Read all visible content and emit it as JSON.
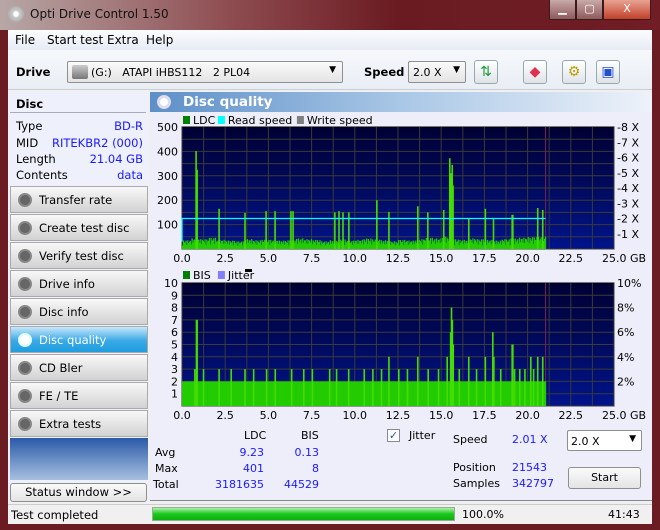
{
  "window": {
    "title": "Opti Drive Control 1.50",
    "minimize": "▁",
    "maximize": "▢",
    "close": "X"
  },
  "menu": [
    "File",
    "Start test",
    "Extra",
    "Help"
  ],
  "toolbar": {
    "drive_label": "Drive",
    "drive_value": "(G:)   ATAPI iHBS112   2 PL04",
    "speed_label": "Speed",
    "speed_value": "2.0 X",
    "icons": [
      "refresh-icon",
      "eraser-icon",
      "settings-icon",
      "save-icon"
    ]
  },
  "disc": {
    "header": "Disc",
    "rows": [
      {
        "label": "Type",
        "value": "BD-R"
      },
      {
        "label": "MID",
        "value": "RITEKBR2 (000)"
      },
      {
        "label": "Length",
        "value": "21.04 GB"
      },
      {
        "label": "Contents",
        "value": "data"
      }
    ]
  },
  "nav": [
    {
      "label": "Transfer rate"
    },
    {
      "label": "Create test disc"
    },
    {
      "label": "Verify test disc"
    },
    {
      "label": "Drive info"
    },
    {
      "label": "Disc info"
    },
    {
      "label": "Disc quality",
      "selected": true
    },
    {
      "label": "CD Bler"
    },
    {
      "label": "FE / TE"
    },
    {
      "label": "Extra tests"
    }
  ],
  "status_window_button": "Status window >>",
  "panel_title": "Disc quality",
  "chart_data": [
    {
      "type": "bar",
      "legend": [
        "LDC",
        "Read speed",
        "Write speed"
      ],
      "legend_colors": [
        "#008000",
        "#00ffff",
        "#808080"
      ],
      "x_ticks": [
        "0.0",
        "2.5",
        "5.0",
        "7.5",
        "10.0",
        "12.5",
        "15.0",
        "17.5",
        "20.0",
        "22.5",
        "25.0 GB"
      ],
      "y_ticks": [
        "500",
        "400",
        "300",
        "200",
        "100"
      ],
      "y2_ticks": [
        "8 X",
        "7 X",
        "6 X",
        "5 X",
        "4 X",
        "3 X",
        "2 X",
        "1 X"
      ],
      "xlim": [
        0,
        25
      ],
      "ylim": [
        0,
        500
      ],
      "y2lim": [
        0,
        8
      ],
      "data_end_gb": 21.04,
      "grid": true,
      "baseline_step_gb": 0.5,
      "baseline": [
        25,
        30,
        28,
        32,
        26,
        24,
        22,
        28,
        25,
        27,
        26,
        24,
        25,
        30,
        28,
        26,
        22,
        25,
        28,
        24,
        26,
        30,
        28,
        25,
        22,
        26,
        24,
        28,
        32,
        30,
        35,
        28,
        26,
        30,
        28,
        26,
        24,
        28,
        30,
        32,
        34,
        35,
        38
      ],
      "spikes": [
        [
          0.77,
          401
        ],
        [
          0.83,
          325
        ],
        [
          2.1,
          165
        ],
        [
          3.6,
          148
        ],
        [
          4.82,
          155
        ],
        [
          5.34,
          155
        ],
        [
          6.26,
          155
        ],
        [
          6.38,
          155
        ],
        [
          8.8,
          150
        ],
        [
          9.04,
          155
        ],
        [
          9.27,
          150
        ],
        [
          9.61,
          150
        ],
        [
          11.23,
          200
        ],
        [
          11.93,
          152
        ],
        [
          13.6,
          175
        ],
        [
          14.18,
          150
        ],
        [
          15.1,
          160
        ],
        [
          15.45,
          372
        ],
        [
          15.53,
          310
        ],
        [
          15.59,
          345
        ],
        [
          15.64,
          260
        ],
        [
          16.55,
          125
        ],
        [
          17.51,
          165
        ],
        [
          17.98,
          125
        ],
        [
          19.06,
          140
        ],
        [
          19.1,
          140
        ],
        [
          20.54,
          168
        ],
        [
          20.83,
          160
        ]
      ],
      "read_speed_x": 2.0
    },
    {
      "type": "bar",
      "legend": [
        "BIS",
        "Jitter"
      ],
      "legend_colors": [
        "#008000",
        "#8080ff"
      ],
      "x_ticks": [
        "0.0",
        "2.5",
        "5.0",
        "7.5",
        "10.0",
        "12.5",
        "15.0",
        "17.5",
        "20.0",
        "22.5",
        "25.0 GB"
      ],
      "y_ticks": [
        "10",
        "9",
        "8",
        "7",
        "6",
        "5",
        "4",
        "3",
        "2",
        "1"
      ],
      "y2_ticks": [
        "10%",
        "8%",
        "6%",
        "4%",
        "2%"
      ],
      "xlim": [
        0,
        25
      ],
      "ylim": [
        0,
        10
      ],
      "y2lim": [
        0,
        10
      ],
      "data_end_gb": 21.04,
      "grid": true,
      "baseline": 2,
      "spikes": [
        [
          0.79,
          7
        ],
        [
          0.83,
          7
        ],
        [
          15.5,
          6
        ],
        [
          15.55,
          8
        ],
        [
          15.6,
          7
        ],
        [
          15.65,
          5
        ],
        [
          17.94,
          6
        ],
        [
          19.06,
          5
        ],
        [
          19.1,
          5
        ],
        [
          11.93,
          4
        ],
        [
          13.6,
          4
        ],
        [
          15.3,
          4
        ],
        [
          16.55,
          4
        ],
        [
          17.51,
          4
        ],
        [
          18.0,
          4
        ],
        [
          20.14,
          4
        ],
        [
          20.54,
          4
        ],
        [
          20.83,
          4
        ],
        [
          0.7,
          3
        ],
        [
          1.2,
          3
        ],
        [
          2.1,
          3
        ],
        [
          2.8,
          3
        ],
        [
          3.6,
          3
        ],
        [
          4.1,
          3
        ],
        [
          4.85,
          3
        ],
        [
          5.35,
          3
        ],
        [
          6.3,
          3
        ],
        [
          7.0,
          3
        ],
        [
          7.5,
          3
        ],
        [
          8.5,
          3
        ],
        [
          8.9,
          3
        ],
        [
          9.6,
          3
        ],
        [
          10.5,
          3
        ],
        [
          11.0,
          3
        ],
        [
          11.5,
          3
        ],
        [
          12.5,
          3
        ],
        [
          13.0,
          3
        ],
        [
          14.2,
          3
        ],
        [
          14.8,
          3
        ],
        [
          16.0,
          3
        ],
        [
          17.0,
          3
        ],
        [
          18.4,
          3
        ],
        [
          19.2,
          3
        ],
        [
          19.5,
          3
        ],
        [
          19.8,
          3
        ],
        [
          20.3,
          3
        ]
      ]
    }
  ],
  "stats": {
    "col_ldc": "LDC",
    "col_bis": "BIS",
    "rows": [
      {
        "label": "Avg",
        "ldc": "9.23",
        "bis": "0.13"
      },
      {
        "label": "Max",
        "ldc": "401",
        "bis": "8"
      },
      {
        "label": "Total",
        "ldc": "3181635",
        "bis": "44529"
      }
    ],
    "jitter_label": "Jitter",
    "jitter_checked": true,
    "speed_label": "Speed",
    "speed_value": "2.01 X",
    "position_label": "Position",
    "position_value": "21543",
    "samples_label": "Samples",
    "samples_value": "342797",
    "speed_select": "2.0 X",
    "start_button": "Start"
  },
  "statusbar": {
    "text": "Test completed",
    "progress_percent": 100,
    "progress_text": "100.0%",
    "time": "41:43"
  }
}
